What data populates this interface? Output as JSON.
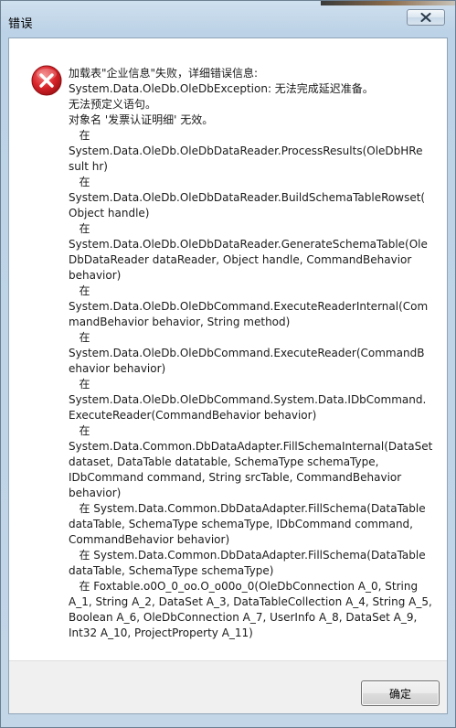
{
  "window": {
    "title": "错误",
    "close_icon": "close-icon"
  },
  "dialog": {
    "icon": "error-icon",
    "icon_color": "#d9252b",
    "message_lines": [
      "加载表\"企业信息\"失败，详细错误信息:",
      "System.Data.OleDb.OleDbException: 无法完成延迟准备。",
      "无法预定义语句。",
      "对象名 '发票认证明细' 无效。",
      "   在",
      "System.Data.OleDb.OleDbDataReader.ProcessResults(OleDbHRe",
      "sult hr)",
      "   在",
      "System.Data.OleDb.OleDbDataReader.BuildSchemaTableRowset(",
      "Object handle)",
      "   在",
      "System.Data.OleDb.OleDbDataReader.GenerateSchemaTable(Ole",
      "DbDataReader dataReader, Object handle, CommandBehavior",
      "behavior)",
      "   在",
      "System.Data.OleDb.OleDbCommand.ExecuteReaderInternal(Com",
      "mandBehavior behavior, String method)",
      "   在",
      "System.Data.OleDb.OleDbCommand.ExecuteReader(CommandB",
      "ehavior behavior)",
      "   在",
      "System.Data.OleDb.OleDbCommand.System.Data.IDbCommand.",
      "ExecuteReader(CommandBehavior behavior)",
      "   在",
      "System.Data.Common.DbDataAdapter.FillSchemaInternal(DataSet",
      "dataset, DataTable datatable, SchemaType schemaType,",
      "IDbCommand command, String srcTable, CommandBehavior",
      "behavior)",
      "   在 System.Data.Common.DbDataAdapter.FillSchema(DataTable",
      "dataTable, SchemaType schemaType, IDbCommand command,",
      "CommandBehavior behavior)",
      "   在 System.Data.Common.DbDataAdapter.FillSchema(DataTable",
      "dataTable, SchemaType schemaType)",
      "   在 Foxtable.o0O_0_oo.O_o00o_0(OleDbConnection A_0, String",
      "A_1, String A_2, DataSet A_3, DataTableCollection A_4, String A_5,",
      "Boolean A_6, OleDbConnection A_7, UserInfo A_8, DataSet A_9,",
      "Int32 A_10, ProjectProperty A_11)"
    ]
  },
  "buttons": {
    "ok_label": "确定"
  }
}
